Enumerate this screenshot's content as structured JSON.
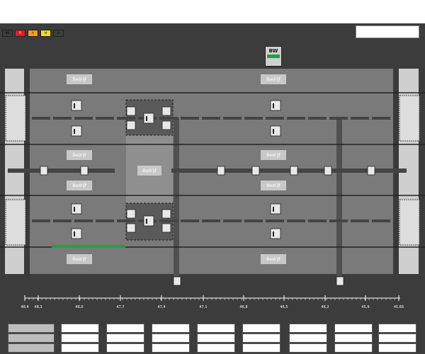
{
  "legend": [
    "NU",
    "R",
    "A",
    "M",
    "B"
  ],
  "legend_colors": [
    "#ffffff",
    "#e02020",
    "#f0a020",
    "#f0e020",
    "#ffffff"
  ],
  "bw": {
    "label": "BW",
    "color": "#1fa14a"
  },
  "zones": [
    {
      "label": "Bedrijf"
    },
    {
      "label": "Bedrijf"
    },
    {
      "label": "Bedrijf"
    },
    {
      "label": "Bedrijf"
    },
    {
      "label": "Bedrijf"
    },
    {
      "label": "Bedrijf"
    },
    {
      "label": "Bedrijf"
    },
    {
      "label": "Bedrijf"
    },
    {
      "label": "Bedrijf"
    }
  ],
  "scale": {
    "ticks": [
      "48,4",
      "48,3",
      "48,0",
      "47,7",
      "47,4",
      "47,1",
      "46,8",
      "46,5",
      "46,2",
      "45,9",
      "45,66"
    ]
  },
  "signal": {
    "glyph": "[|G"
  },
  "colors": {
    "background": "#3c3c3c",
    "lane": "#7a7a7a",
    "accent": "#1fa14a"
  }
}
